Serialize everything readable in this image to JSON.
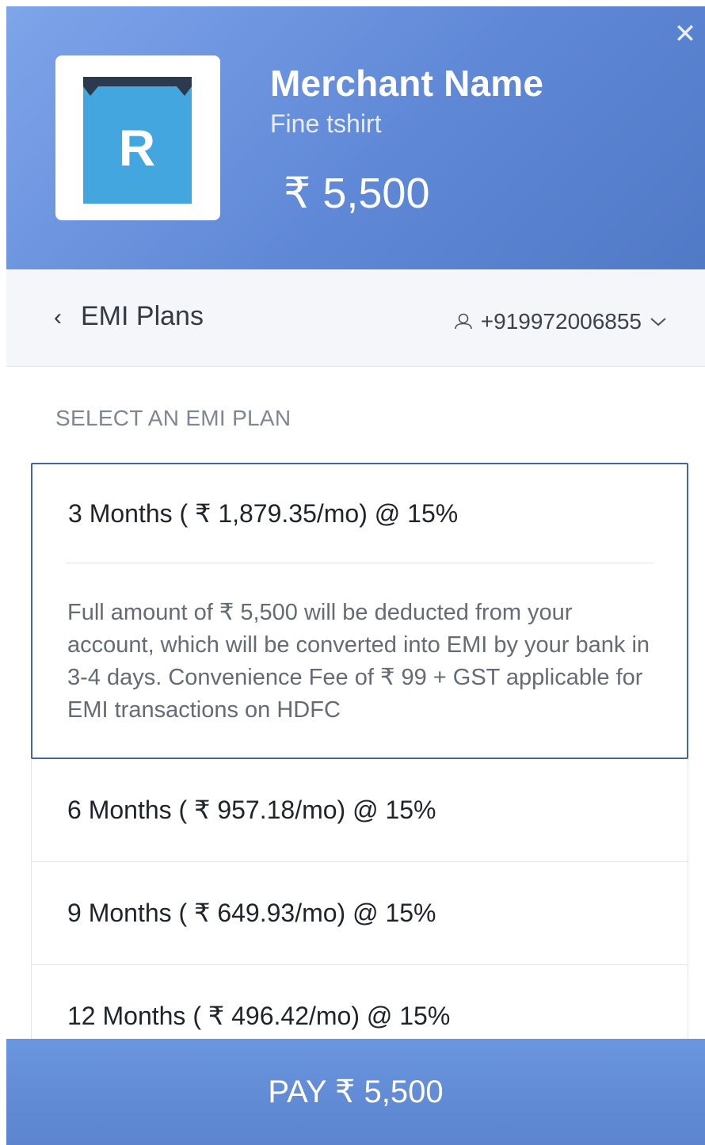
{
  "header": {
    "close_icon": "close-icon",
    "logo_letter": "R",
    "merchant_name": "Merchant Name",
    "product": "Fine tshirt",
    "amount": "₹ 5,500"
  },
  "subbar": {
    "back_label": "EMI Plans",
    "phone": "+919972006855"
  },
  "section_title": "SELECT AN EMI PLAN",
  "plans": [
    {
      "label": "3 Months ( ₹  1,879.35/mo)  @ 15%",
      "note": "Full amount of  ₹  5,500 will be deducted from your account, which will be converted into EMI by your bank in 3-4 days. Convenience Fee of  ₹ 99 + GST applicable for EMI transactions on HDFC"
    },
    {
      "label": "6 Months ( ₹  957.18/mo)  @ 15%"
    },
    {
      "label": "9 Months ( ₹  649.93/mo)  @ 15%"
    },
    {
      "label": "12 Months ( ₹  496.42/mo)  @ 15%"
    }
  ],
  "pay_button": "PAY  ₹  5,500",
  "colors": {
    "header_start": "#7ea4ea",
    "header_end": "#5079c6",
    "logo_blue": "#43a6de",
    "selected_border": "#44659f",
    "pay_bar": "#6590dc"
  }
}
